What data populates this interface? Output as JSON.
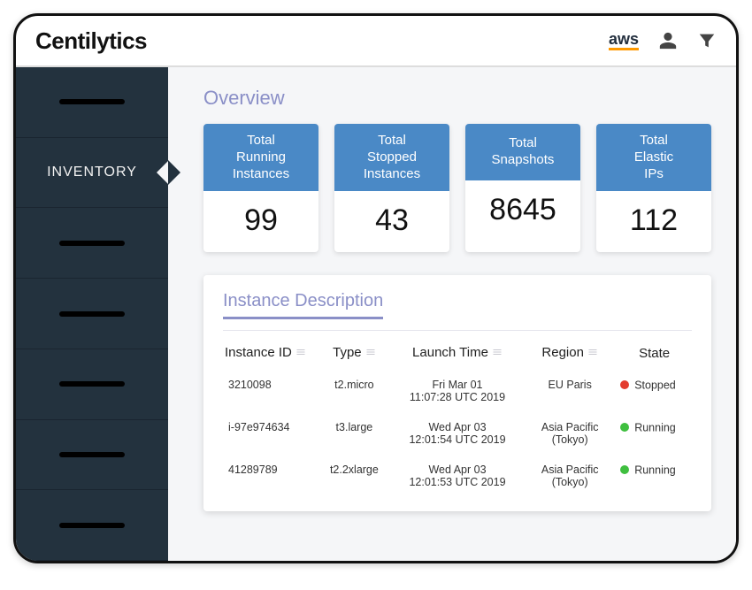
{
  "brand": "Centilytics",
  "cloud_provider": "aws",
  "sidebar": {
    "active_label": "INVENTORY"
  },
  "overview": {
    "title": "Overview",
    "cards": [
      {
        "label": "Total\nRunning\nInstances",
        "value": "99"
      },
      {
        "label": "Total\nStopped\nInstances",
        "value": "43"
      },
      {
        "label": "Total\nSnapshots",
        "value": "8645"
      },
      {
        "label": "Total\nElastic\nIPs",
        "value": "112"
      }
    ]
  },
  "instances": {
    "title": "Instance Description",
    "columns": {
      "id": "Instance ID",
      "type": "Type",
      "launch": "Launch Time",
      "region": "Region",
      "state": "State"
    },
    "rows": [
      {
        "id": "3210098",
        "type": "t2.micro",
        "launch": "Fri Mar 01\n11:07:28 UTC 2019",
        "region": "EU Paris",
        "state": "Stopped",
        "state_color": "#e33b2e"
      },
      {
        "id": "i-97e974634",
        "type": "t3.large",
        "launch": "Wed Apr 03\n12:01:54 UTC 2019",
        "region": "Asia Pacific\n(Tokyo)",
        "state": "Running",
        "state_color": "#3fbf3f"
      },
      {
        "id": "41289789",
        "type": "t2.2xlarge",
        "launch": "Wed Apr 03\n12:01:53 UTC 2019",
        "region": "Asia Pacific\n(Tokyo)",
        "state": "Running",
        "state_color": "#3fbf3f"
      }
    ]
  }
}
